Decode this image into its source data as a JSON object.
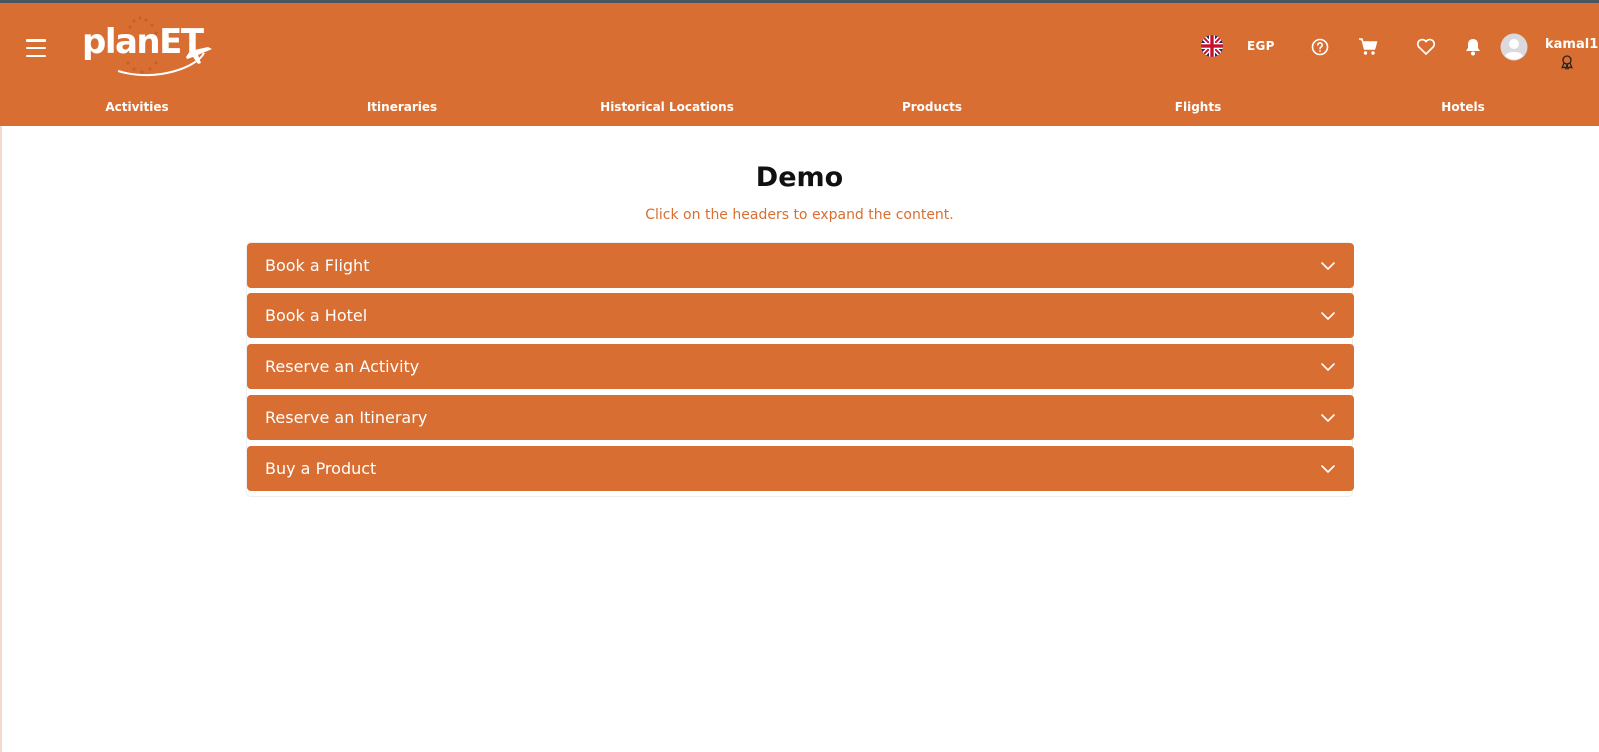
{
  "app": {
    "logo_text": "planET"
  },
  "header": {
    "currency": "EGP",
    "username": "kamal1",
    "accent_color": "#d86e31"
  },
  "icons": {
    "menu": "hamburger-menu-icon",
    "language": "uk-flag-icon",
    "help": "help-circle-icon",
    "cart": "shopping-cart-icon",
    "wishlist": "heart-icon",
    "notifications": "bell-icon",
    "avatar": "user-avatar-icon",
    "badge": "award-badge-icon",
    "chevron": "chevron-down-icon"
  },
  "nav": {
    "items": [
      {
        "label": "Activities"
      },
      {
        "label": "Itineraries"
      },
      {
        "label": "Historical Locations"
      },
      {
        "label": "Products"
      },
      {
        "label": "Flights"
      },
      {
        "label": "Hotels"
      }
    ]
  },
  "main": {
    "title": "Demo",
    "subtitle": "Click on the headers to expand the content.",
    "accordion": [
      {
        "label": "Book a Flight",
        "expanded": false
      },
      {
        "label": "Book a Hotel",
        "expanded": false
      },
      {
        "label": "Reserve an Activity",
        "expanded": false
      },
      {
        "label": "Reserve an Itinerary",
        "expanded": false
      },
      {
        "label": "Buy a Product",
        "expanded": false
      }
    ]
  }
}
